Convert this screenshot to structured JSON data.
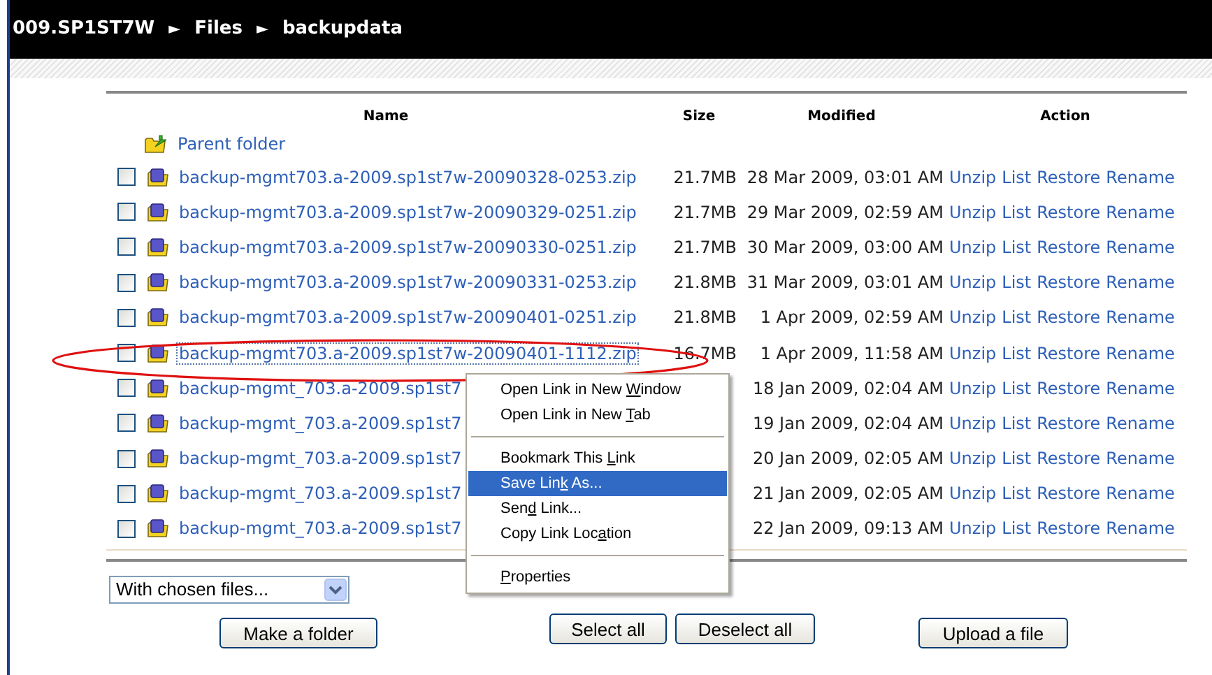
{
  "breadcrumb": [
    "009.SP1ST7W",
    "Files",
    "backupdata"
  ],
  "breadcrumb_separator": "►",
  "table": {
    "columns": [
      "Name",
      "Size",
      "Modified",
      "Action"
    ],
    "parent_folder": "Parent folder",
    "rows": [
      {
        "name": "backup-mgmt703.a-2009.sp1st7w-20090328-0253.zip",
        "size": "21.7MB",
        "modified": "28 Mar 2009, 03:01 AM",
        "checked": false,
        "focused": false,
        "actions": [
          "Unzip",
          "List",
          "Restore",
          "Rename"
        ]
      },
      {
        "name": "backup-mgmt703.a-2009.sp1st7w-20090329-0251.zip",
        "size": "21.7MB",
        "modified": "29 Mar 2009, 02:59 AM",
        "checked": false,
        "focused": false,
        "actions": [
          "Unzip",
          "List",
          "Restore",
          "Rename"
        ]
      },
      {
        "name": "backup-mgmt703.a-2009.sp1st7w-20090330-0251.zip",
        "size": "21.7MB",
        "modified": "30 Mar 2009, 03:00 AM",
        "checked": false,
        "focused": false,
        "actions": [
          "Unzip",
          "List",
          "Restore",
          "Rename"
        ]
      },
      {
        "name": "backup-mgmt703.a-2009.sp1st7w-20090331-0253.zip",
        "size": "21.8MB",
        "modified": "31 Mar 2009, 03:01 AM",
        "checked": false,
        "focused": false,
        "actions": [
          "Unzip",
          "List",
          "Restore",
          "Rename"
        ]
      },
      {
        "name": "backup-mgmt703.a-2009.sp1st7w-20090401-0251.zip",
        "size": "21.8MB",
        "modified": "1 Apr 2009, 02:59 AM",
        "checked": false,
        "focused": false,
        "actions": [
          "Unzip",
          "List",
          "Restore",
          "Rename"
        ]
      },
      {
        "name": "backup-mgmt703.a-2009.sp1st7w-20090401-1112.zip",
        "size": "16.7MB",
        "modified": "1 Apr 2009, 11:58 AM",
        "checked": false,
        "focused": true,
        "actions": [
          "Unzip",
          "List",
          "Restore",
          "Rename"
        ]
      },
      {
        "name": "backup-mgmt_703.a-2009.sp1st7",
        "modified": "18 Jan 2009, 02:04 AM",
        "checked": false,
        "focused": false,
        "actions": [
          "Unzip",
          "List",
          "Restore",
          "Rename"
        ]
      },
      {
        "name": "backup-mgmt_703.a-2009.sp1st7",
        "modified": "19 Jan 2009, 02:04 AM",
        "checked": false,
        "focused": false,
        "actions": [
          "Unzip",
          "List",
          "Restore",
          "Rename"
        ]
      },
      {
        "name": "backup-mgmt_703.a-2009.sp1st7",
        "modified": "20 Jan 2009, 02:05 AM",
        "checked": false,
        "focused": false,
        "actions": [
          "Unzip",
          "List",
          "Restore",
          "Rename"
        ]
      },
      {
        "name": "backup-mgmt_703.a-2009.sp1st7",
        "modified": "21 Jan 2009, 02:05 AM",
        "checked": false,
        "focused": false,
        "actions": [
          "Unzip",
          "List",
          "Restore",
          "Rename"
        ]
      },
      {
        "name": "backup-mgmt_703.a-2009.sp1st7",
        "modified": "22 Jan 2009, 09:13 AM",
        "checked": false,
        "focused": false,
        "actions": [
          "Unzip",
          "List",
          "Restore",
          "Rename"
        ]
      }
    ]
  },
  "context_menu": [
    {
      "kind": "item",
      "before": "Open Link in New ",
      "key": "W",
      "after": "indow",
      "selected": false
    },
    {
      "kind": "item",
      "before": "Open Link in New ",
      "key": "T",
      "after": "ab",
      "selected": false
    },
    {
      "kind": "separator"
    },
    {
      "kind": "item",
      "before": "Bookmark This ",
      "key": "L",
      "after": "ink",
      "selected": false
    },
    {
      "kind": "item",
      "before": "Save Lin",
      "key": "k",
      "after": " As...",
      "selected": true
    },
    {
      "kind": "item",
      "before": "Sen",
      "key": "d",
      "after": " Link...",
      "selected": false
    },
    {
      "kind": "item",
      "before": "Copy Link Loc",
      "key": "a",
      "after": "tion",
      "selected": false
    },
    {
      "kind": "separator"
    },
    {
      "kind": "item",
      "key": "P",
      "after": "roperties",
      "selected": false
    }
  ],
  "bulk_action_select": {
    "value": "With chosen files..."
  },
  "buttons": [
    "Make a folder",
    "Select all",
    "Deselect all",
    "Upload a file"
  ]
}
